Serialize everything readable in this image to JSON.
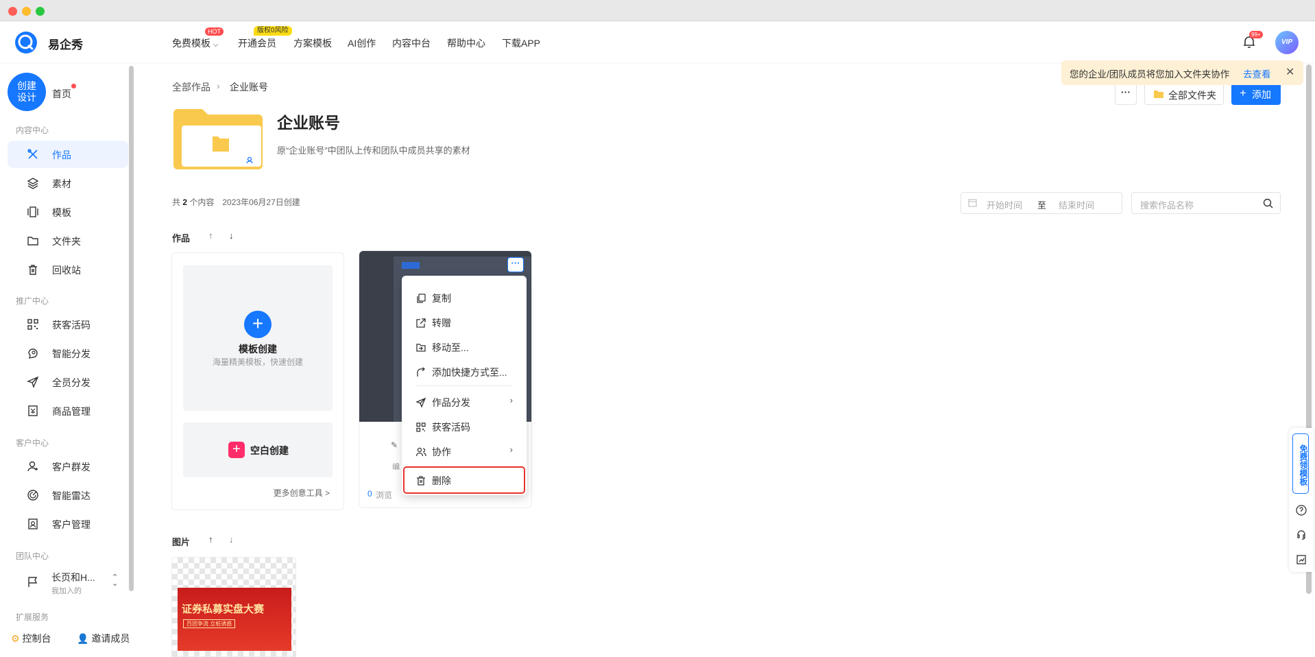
{
  "window": {
    "dots": [
      "#ff5f57",
      "#febc2e",
      "#28c840"
    ]
  },
  "topbar": {
    "brand": "易企秀",
    "nav": [
      {
        "label": "免费模板",
        "badge": "HOT"
      },
      {
        "label": "开通会员",
        "badge": "版权0风险"
      },
      {
        "label": "方案模板"
      },
      {
        "label": "AI创作"
      },
      {
        "label": "内容中台"
      },
      {
        "label": "帮助中心"
      },
      {
        "label": "下载APP"
      }
    ],
    "notif_count": "99+",
    "vip": "VIP"
  },
  "sidebar": {
    "create": "创建设计",
    "home": "首页",
    "sections": [
      "内容中心",
      "推广中心",
      "客户中心",
      "团队中心",
      "扩展服务"
    ],
    "items": [
      {
        "label": "作品",
        "icon": "tools-icon"
      },
      {
        "label": "素材",
        "icon": "layers-icon"
      },
      {
        "label": "模板",
        "icon": "template-icon"
      },
      {
        "label": "文件夹",
        "icon": "folder-icon"
      },
      {
        "label": "回收站",
        "icon": "trash-icon"
      },
      {
        "label": "获客活码",
        "icon": "qrcode-icon"
      },
      {
        "label": "智能分发",
        "icon": "brain-icon"
      },
      {
        "label": "全员分发",
        "icon": "send-icon"
      },
      {
        "label": "商品管理",
        "icon": "goods-icon"
      },
      {
        "label": "客户群发",
        "icon": "user-broadcast-icon"
      },
      {
        "label": "智能雷达",
        "icon": "radar-icon"
      },
      {
        "label": "客户管理",
        "icon": "contact-icon"
      }
    ],
    "team": {
      "name": "长页和H...",
      "sub": "我加入的"
    },
    "console": "控制台",
    "invite": "邀请成员"
  },
  "main": {
    "breadcrumb": [
      "全部作品",
      "企业账号"
    ],
    "title": "企业账号",
    "desc": "原“企业账号”中团队上传和团队中成员共享的素材",
    "meta_prefix": "共 ",
    "meta_count": "2",
    "meta_suffix": " 个内容",
    "created": "2023年06月27日创建",
    "date_start": "开始时间",
    "date_to": "至",
    "date_end": "结束时间",
    "search_placeholder": "搜索作品名称",
    "works_label": "作品",
    "images_label": "图片",
    "all_folders": "全部文件夹",
    "add": "添加",
    "more": "···"
  },
  "create_card": {
    "tpl_title": "模板创建",
    "tpl_sub": "海量精美模板，快速创建",
    "blank": "空白创建",
    "more_tools": "更多创意工具 >"
  },
  "work_card": {
    "views": "0",
    "views_label": "浏览",
    "edit_label": "编"
  },
  "context_menu": [
    {
      "label": "复制",
      "icon": "copy-icon"
    },
    {
      "label": "转赠",
      "icon": "share-out-icon"
    },
    {
      "label": "移动至...",
      "icon": "move-icon"
    },
    {
      "label": "添加快捷方式至...",
      "icon": "shortcut-icon"
    },
    {
      "label": "作品分发",
      "icon": "send-icon",
      "sub": true
    },
    {
      "label": "获客活码",
      "icon": "qrcode-icon"
    },
    {
      "label": "协作",
      "icon": "collab-icon",
      "sub": true
    },
    {
      "label": "删除",
      "icon": "trash-icon",
      "highlight": true
    }
  ],
  "toast": {
    "text": "您的企业/团队成员将您加入文件夹协作",
    "link": "去查看"
  },
  "right_panel": {
    "free": "免费领模板"
  },
  "poster": {
    "title": "证券私募实盘大赛",
    "line": "百团争流  立桩诱惑"
  },
  "colors": {
    "accent": "#1677ff",
    "danger": "#ff4d4f"
  }
}
